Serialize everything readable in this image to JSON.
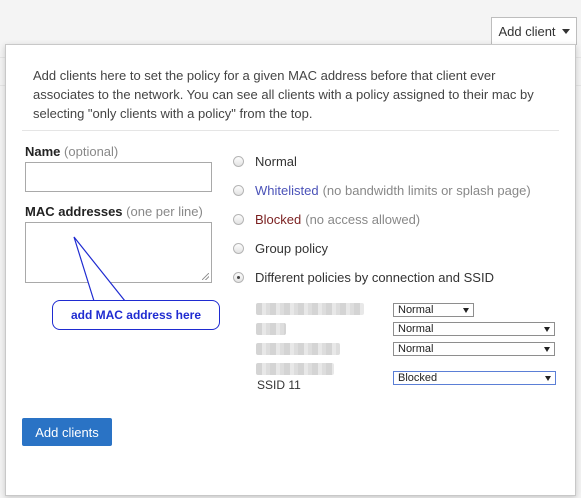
{
  "header": {
    "add_client_label": "Add client"
  },
  "dialog": {
    "intro": "Add clients here to set the policy for a given MAC address before that client ever associates to the network. You can see all clients with a policy assigned to their mac by selecting \"only clients with a policy\" from the top.",
    "name_label": "Name",
    "name_hint": "(optional)",
    "mac_label": "MAC addresses",
    "mac_hint": "(one per line)",
    "callout": "add MAC address here",
    "policies": [
      {
        "label": "Normal",
        "note": ""
      },
      {
        "label": "Whitelisted",
        "note": "(no bandwidth limits or splash page)"
      },
      {
        "label": "Blocked",
        "note": "(no access allowed)"
      },
      {
        "label": "Group policy",
        "note": ""
      },
      {
        "label": "Different policies by connection and SSID",
        "note": ""
      }
    ],
    "selected_policy": "Different policies by connection and SSID",
    "ssid_rows": [
      {
        "name": "",
        "policy": "Normal"
      },
      {
        "name": "",
        "policy": "Normal"
      },
      {
        "name": "",
        "policy": "Normal"
      },
      {
        "name": "SSID 11",
        "policy": "Blocked"
      }
    ],
    "submit_label": "Add clients"
  }
}
